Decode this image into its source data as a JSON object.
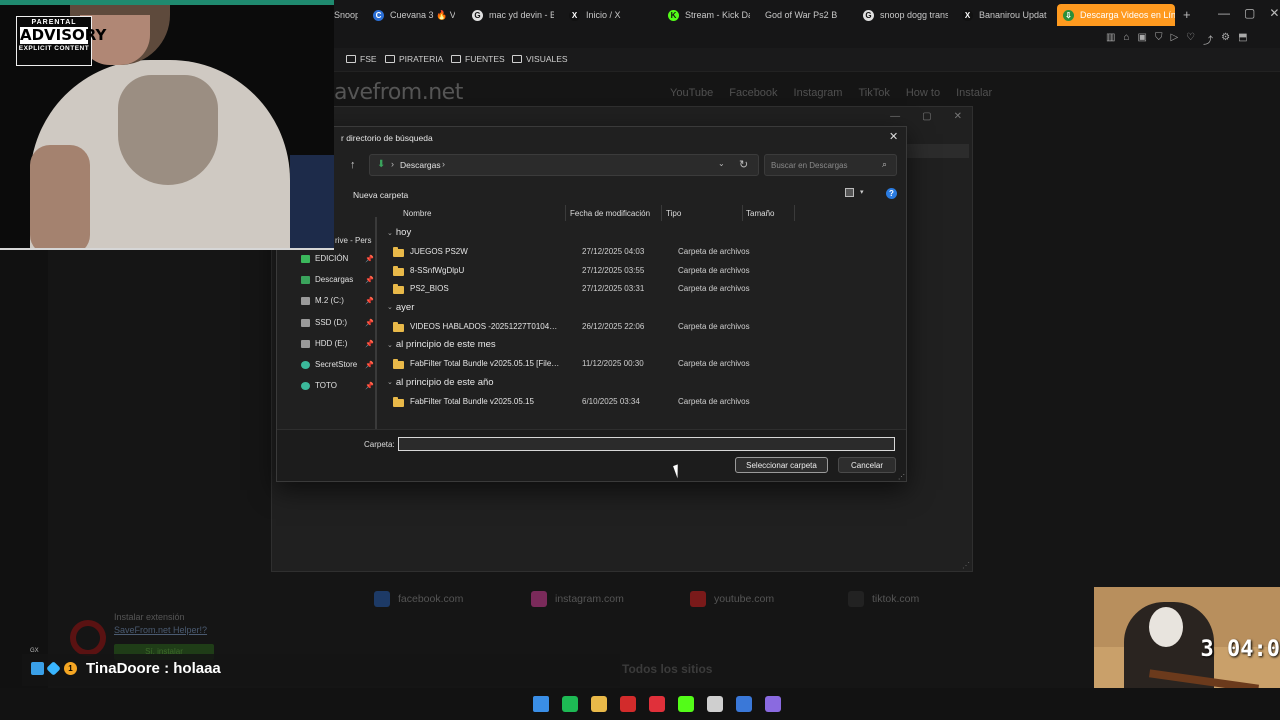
{
  "browser": {
    "tabs": [
      {
        "label": "Snoop D",
        "color": "#444444",
        "glyph": ""
      },
      {
        "label": "Cuevana 3 🔥 Ve",
        "color": "#2b6fd6",
        "glyph": "C"
      },
      {
        "label": "mac yd devin - B",
        "color": "#e0e0e0",
        "glyph": "G"
      },
      {
        "label": "Inicio / X",
        "color": "#111111",
        "glyph": "X"
      },
      {
        "label": "Stream - Kick Da",
        "color": "#53fc18",
        "glyph": "K"
      },
      {
        "label": "God of War Ps2 B",
        "color": "#2b6fd6",
        "glyph": ""
      },
      {
        "label": "snoop dogg trans",
        "color": "#e0e0e0",
        "glyph": "G"
      },
      {
        "label": "Bananirou Updat",
        "color": "#111111",
        "glyph": "X"
      },
      {
        "label": "Descarga Videos en Línea",
        "color": "#2c8f3a",
        "glyph": "⇩",
        "active": true
      }
    ],
    "add_tab": "+",
    "window_controls": [
      "—",
      "▢",
      "✕"
    ],
    "toolbar_icons": [
      "▥",
      "⌂",
      "▣",
      "⛉",
      "▷",
      "♡",
      "⤴",
      "⚙",
      "⬒"
    ],
    "bookmarks": [
      "FSE",
      "PIRATERIA",
      "FUENTES",
      "VISUALES"
    ]
  },
  "site": {
    "logo": "avefrom.net",
    "nav": [
      "YouTube",
      "Facebook",
      "Instagram",
      "TikTok",
      "How to",
      "Instalar"
    ],
    "social": [
      {
        "label": "facebook.com",
        "color": "#1d3a66"
      },
      {
        "label": "instagram.com",
        "color": "#7a2a5a"
      },
      {
        "label": "youtube.com",
        "color": "#7a1a1a"
      },
      {
        "label": "tiktok.com",
        "color": "#222222"
      }
    ],
    "all_sites": "Todos los sitios",
    "extension": {
      "line1": "Instalar extensión",
      "line2": "SaveFrom.net Helper!?",
      "button": "Sí, instalar"
    }
  },
  "dialog": {
    "title": "r directorio de búsqueda",
    "close": "✕",
    "up": "↑",
    "address": {
      "path": "Descargas",
      "sep": "›",
      "dropdown": "⌄",
      "refresh": "↻"
    },
    "search_placeholder": "Buscar en Descargas",
    "search_icon": "⌕",
    "new_folder": "Nueva carpeta",
    "help": "?",
    "view_drop": "▾",
    "nav_partial": "rive - Pers",
    "nav_items": [
      {
        "label": "EDICIÓN",
        "icon": "tree-icon",
        "color": "#3bb85c"
      },
      {
        "label": "Descargas",
        "icon": "download-icon",
        "color": "#3aa35c"
      },
      {
        "label": "M.2 (C:)",
        "icon": "drive-icon",
        "color": "#9a9a9a"
      },
      {
        "label": "SSD (D:)",
        "icon": "drive-icon",
        "color": "#9a9a9a"
      },
      {
        "label": "HDD (E:)",
        "icon": "drive-icon",
        "color": "#9a9a9a"
      },
      {
        "label": "SecretStore",
        "icon": "user-icon",
        "color": "#3bb89a"
      },
      {
        "label": "TOTO",
        "icon": "user-icon",
        "color": "#3bb89a"
      }
    ],
    "pin": "📌",
    "columns": [
      "Nombre",
      "Fecha de modificación",
      "Tipo",
      "Tamaño"
    ],
    "groups": [
      {
        "label": "hoy",
        "rows": [
          {
            "name": "JUEGOS PS2W",
            "date": "27/12/2025 04:03",
            "type": "Carpeta de archivos"
          },
          {
            "name": "8-SSnfWgDlpU",
            "date": "27/12/2025 03:55",
            "type": "Carpeta de archivos"
          },
          {
            "name": "PS2_BIOS",
            "date": "27/12/2025 03:31",
            "type": "Carpeta de archivos"
          }
        ]
      },
      {
        "label": "ayer",
        "rows": [
          {
            "name": "VIDEOS HABLADOS -20251227T010438Z-...",
            "date": "26/12/2025 22:06",
            "type": "Carpeta de archivos"
          }
        ]
      },
      {
        "label": "al principio de este mes",
        "rows": [
          {
            "name": "FabFilter Total Bundle v2025.05.15 [FileCR]",
            "date": "11/12/2025 00:30",
            "type": "Carpeta de archivos"
          }
        ]
      },
      {
        "label": "al principio de este año",
        "rows": [
          {
            "name": "FabFilter Total Bundle v2025.05.15",
            "date": "6/10/2025 03:34",
            "type": "Carpeta de archivos"
          }
        ]
      }
    ],
    "folder_label": "Carpeta:",
    "folder_value": "",
    "select_button": "Seleccionar carpeta",
    "cancel_button": "Cancelar"
  },
  "overlay": {
    "parental": {
      "top": "PARENTAL",
      "mid": "ADVISORY",
      "bottom": "EXPLICIT CONTENT"
    },
    "chat": {
      "user": "TinaDoore",
      "sep": " : ",
      "message": "holaaa",
      "badge": "1",
      "gx": "GX"
    },
    "game_timer": "3   04:0"
  },
  "taskbar": {
    "icons": [
      {
        "name": "windows-start-icon",
        "color": "#3a8ee6"
      },
      {
        "name": "spotify-icon",
        "color": "#1db954"
      },
      {
        "name": "file-explorer-icon",
        "color": "#e9b949"
      },
      {
        "name": "opera-icon",
        "color": "#d22b2b"
      },
      {
        "name": "flash-icon",
        "color": "#e0303a"
      },
      {
        "name": "kick-icon",
        "color": "#53fc18"
      },
      {
        "name": "chrome-icon",
        "color": "#cfcfcf"
      },
      {
        "name": "app-icon",
        "color": "#3a78d8"
      },
      {
        "name": "app2-icon",
        "color": "#8a6ae0"
      }
    ]
  }
}
